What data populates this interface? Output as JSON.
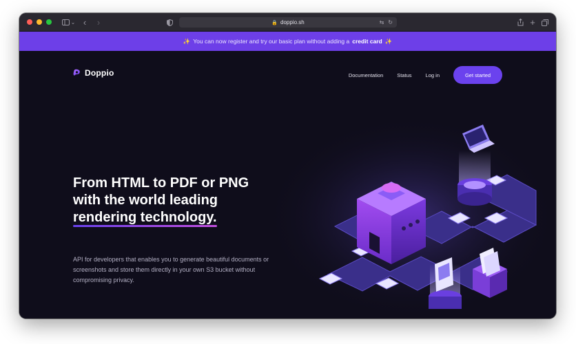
{
  "browser": {
    "url": "doppio.sh",
    "traffic_lights": [
      "#ff5f57",
      "#febc2e",
      "#28c840"
    ]
  },
  "banner": {
    "prefix_icon": "✨",
    "text": "You can now register and try our basic plan without adding a",
    "emphasis": "credit card",
    "suffix_icon": "✨",
    "color": "#6d3fe8"
  },
  "nav": {
    "logo_text": "Doppio",
    "links": [
      "Documentation",
      "Status",
      "Log in"
    ],
    "cta_label": "Get started"
  },
  "hero": {
    "title_line1": "From HTML to PDF or PNG",
    "title_line2": "with the world leading",
    "title_highlight": "rendering technology.",
    "subtitle": "API for developers that enables you to generate beautiful documents or screenshots and store them directly in your own S3 bucket without compromising privacy."
  },
  "colors": {
    "accent": "#6b42ee",
    "page_bg": "#0f0d1b"
  }
}
